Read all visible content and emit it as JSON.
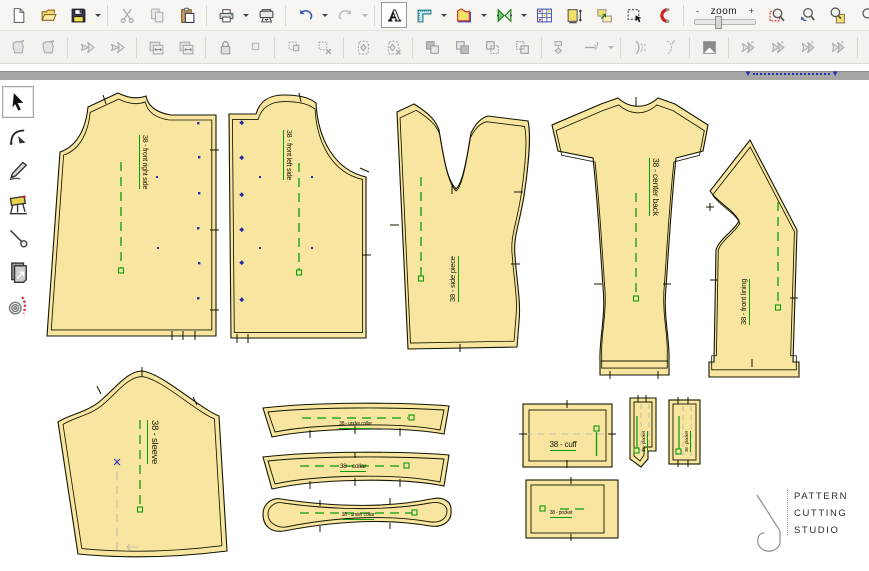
{
  "window": {
    "canvas_bg": "#ffffff",
    "toolbar_bg": "#f6f5f1",
    "graybar_color": "#a6a6a6"
  },
  "colors": {
    "piece_fill": "#f8e6a0",
    "piece_outline": "#141400",
    "grain_green": "#0a9a0a",
    "mark_blue": "#2a2aa8",
    "construction_gray": "#c4bda2",
    "disabled_icon": "#aaaaaa"
  },
  "toolbar_main": {
    "zoom_control": {
      "minus": "-",
      "label": "zoom",
      "plus": "+"
    },
    "buttons": [
      {
        "name": "new-file-button",
        "icon": "new-file",
        "group": 1
      },
      {
        "name": "open-file-button",
        "icon": "open-folder",
        "group": 1
      },
      {
        "name": "save-button",
        "icon": "save",
        "group": 1,
        "dropdown": true
      },
      {
        "name": "cut-button",
        "icon": "cut",
        "group": 2,
        "disabled": true
      },
      {
        "name": "copy-button",
        "icon": "copy",
        "group": 2,
        "disabled": true
      },
      {
        "name": "paste-button",
        "icon": "paste",
        "group": 2
      },
      {
        "name": "print-button",
        "icon": "print",
        "group": 3,
        "dropdown": true
      },
      {
        "name": "plot-button",
        "icon": "plotter",
        "group": 3
      },
      {
        "name": "undo-button",
        "icon": "undo",
        "group": 4,
        "dropdown": true
      },
      {
        "name": "redo-button",
        "icon": "redo",
        "group": 4,
        "disabled": true,
        "dropdown": true
      },
      {
        "name": "text-tool-button",
        "icon": "letter-a",
        "group": 5,
        "pressed": true
      },
      {
        "name": "ruler-button",
        "icon": "corner-ruler",
        "group": 5,
        "dropdown": true
      },
      {
        "name": "pattern-style-button",
        "icon": "pattern-colored",
        "group": 5,
        "dropdown": true
      },
      {
        "name": "mirror-button",
        "icon": "mirror-green",
        "group": 5,
        "dropdown": true
      },
      {
        "name": "grading-table-button",
        "icon": "grid-colored",
        "group": 5
      },
      {
        "name": "measure-piece-button",
        "icon": "measure-page",
        "group": 5
      },
      {
        "name": "arrange-pieces-button",
        "icon": "pieces-yellow",
        "group": 5
      },
      {
        "name": "select-area-button",
        "icon": "select-area",
        "group": 5
      },
      {
        "name": "snap-magnet-button",
        "icon": "magnet",
        "group": 5
      }
    ],
    "zoom_buttons": [
      {
        "name": "zoom-area-button",
        "icon": "zoom-area",
        "group": 7
      },
      {
        "name": "zoom-previous-button",
        "icon": "zoom-undo",
        "group": 7
      },
      {
        "name": "zoom-page-button",
        "icon": "zoom-page",
        "group": 7
      },
      {
        "name": "zoom-all-button",
        "icon": "zoom-all",
        "group": 7
      }
    ]
  },
  "toolbar_secondary": {
    "buttons": [
      {
        "name": "copy-piece-button",
        "icon": "g-piece",
        "group": 1,
        "disabled": true
      },
      {
        "name": "move-piece-button",
        "icon": "g-piece",
        "group": 1,
        "disabled": true
      },
      {
        "name": "trace-seam-button",
        "icon": "g-scissor",
        "group": 2,
        "disabled": true
      },
      {
        "name": "cut-seam-button",
        "icon": "g-scissor",
        "group": 2,
        "disabled": true
      },
      {
        "name": "swap-width-button",
        "icon": "g-pages-h",
        "group": 3,
        "disabled": true
      },
      {
        "name": "swap-piece-button",
        "icon": "g-pages-h",
        "group": 3,
        "disabled": true
      },
      {
        "name": "lock-piece-button",
        "icon": "g-lock",
        "group": 4,
        "disabled": true
      },
      {
        "name": "unlock-piece-button",
        "icon": "g-square",
        "group": 4,
        "disabled": true
      },
      {
        "name": "move-selection-button",
        "icon": "g-dotted-move",
        "group": 5,
        "disabled": true
      },
      {
        "name": "delete-selection-button",
        "icon": "g-dotted-x",
        "group": 5,
        "disabled": true
      },
      {
        "name": "piece-dart-button",
        "icon": "g-blob-diamond",
        "group": 6,
        "disabled": true
      },
      {
        "name": "delete-dart-button",
        "icon": "g-blob-diamond-x",
        "group": 6,
        "disabled": true
      },
      {
        "name": "bring-front-button",
        "icon": "g-overlap1",
        "group": 7,
        "disabled": true
      },
      {
        "name": "send-back-button",
        "icon": "g-overlap2",
        "group": 7,
        "disabled": true
      },
      {
        "name": "bring-forward-button",
        "icon": "g-overlap3",
        "group": 7,
        "disabled": true
      },
      {
        "name": "send-backward-button",
        "icon": "g-overlap4",
        "group": 7,
        "disabled": true
      },
      {
        "name": "flow-layout-button",
        "icon": "g-flow",
        "group": 8,
        "disabled": true
      },
      {
        "name": "extend-line-button",
        "icon": "g-extend",
        "group": 8,
        "disabled": true,
        "dropdown": true
      },
      {
        "name": "curve-points-button",
        "icon": "g-curve1",
        "group": 9,
        "disabled": true
      },
      {
        "name": "curve-trace-button",
        "icon": "g-curve2",
        "group": 9,
        "disabled": true
      },
      {
        "name": "invert-selection-button",
        "icon": "g-invert",
        "group": 10,
        "disabled": true
      },
      {
        "name": "notch-tool-1-button",
        "icon": "g-notch",
        "group": 11,
        "disabled": true
      },
      {
        "name": "notch-tool-2-button",
        "icon": "g-notch",
        "group": 11,
        "disabled": true
      },
      {
        "name": "notch-tool-3-button",
        "icon": "g-notch",
        "group": 11,
        "disabled": true
      },
      {
        "name": "notch-tool-4-button",
        "icon": "g-notch",
        "group": 11,
        "disabled": true
      },
      {
        "name": "new-window-button",
        "icon": "g-rect",
        "group": 12,
        "disabled": true
      }
    ]
  },
  "page_bar": {
    "start_marker": "▼",
    "end_marker": "▼"
  },
  "tool_palette": {
    "tools": [
      {
        "name": "pointer-tool",
        "icon": "pointer",
        "selected": true
      },
      {
        "name": "curve-edit-tool",
        "icon": "curve-tool"
      },
      {
        "name": "pen-tool",
        "icon": "pen-tool"
      },
      {
        "name": "drafting-table-tool",
        "icon": "drafting-table-tool"
      },
      {
        "name": "pin-tool",
        "icon": "pin-tool"
      },
      {
        "name": "copy-sheets-tool",
        "icon": "sheets-tool"
      },
      {
        "name": "stitch-tool",
        "icon": "stitch-tool"
      }
    ]
  },
  "pieces": [
    {
      "id": "front-right-side",
      "label": "38 - front right side"
    },
    {
      "id": "front-left-side",
      "label": "38 - front left side"
    },
    {
      "id": "side-piece",
      "label": "38 - side piece"
    },
    {
      "id": "center-back",
      "label": "38 - center back"
    },
    {
      "id": "front-lining",
      "label": "38 - front lining"
    },
    {
      "id": "sleeve",
      "label": "38 - sleeve"
    },
    {
      "id": "under-collar",
      "label": "38 - under collar"
    },
    {
      "id": "collar",
      "label": "38 - collar"
    },
    {
      "id": "collar-band",
      "label": "38 - under collar"
    },
    {
      "id": "cuff",
      "label": "38 - cuff"
    },
    {
      "id": "placket-left",
      "label": "38 - placket"
    },
    {
      "id": "placket-right",
      "label": "38 - placket"
    },
    {
      "id": "pocket",
      "label": "38 - pocket"
    }
  ],
  "logo": {
    "line1": "PATTERN",
    "line2": "CUTTING",
    "line3": "STUDIO"
  }
}
